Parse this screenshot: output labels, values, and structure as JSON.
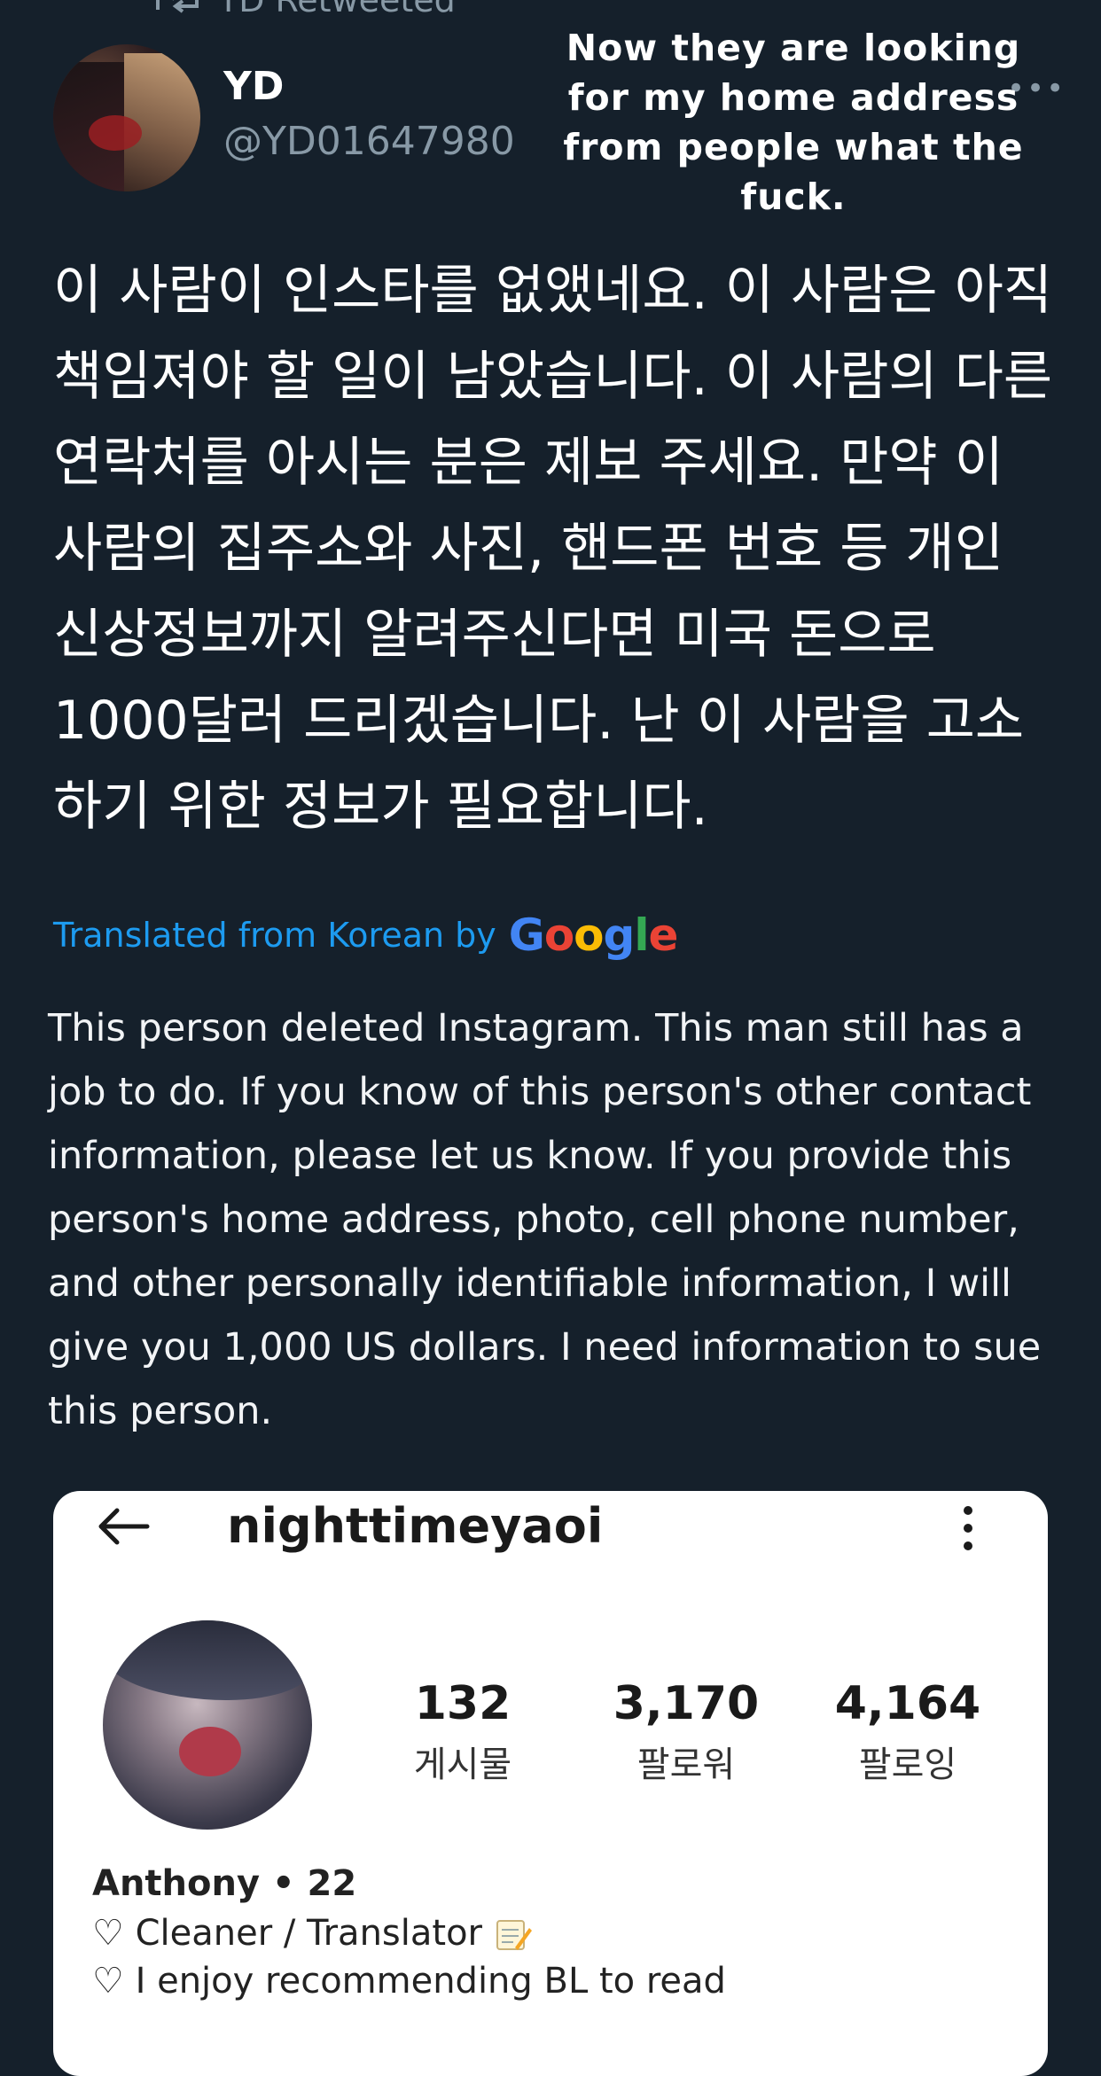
{
  "retweet": {
    "label": "YD Retweeted"
  },
  "tweet": {
    "author_name": "YD",
    "author_handle": "@YD01647980",
    "more_label": "•••",
    "korean_text": "이 사람이 인스타를 없앴네요. 이 사람은 아직 책임져야 할 일이 남았습니다. 이 사람의 다른 연락처를 아시는 분은 제보 주세요. 만약 이 사람의 집주소와 사진, 핸드폰 번호 등 개인 신상정보까지 알려주신다면 미국 돈으로 1000달러 드리겠습니다. 난 이 사람을 고소하기 위한 정보가 필요합니다.",
    "translated_label": "Translated from Korean by",
    "translator_brand": "Google",
    "english_text": "This person deleted Instagram. This man still has a job to do. If you know of this person's other contact information, please let us know. If you provide this person's home address, photo, cell phone number, and other personally identifiable information, I will give you 1,000 US dollars. I need information to sue this person."
  },
  "overlay_caption": "Now they are looking for my home address from people what the fuck.",
  "instagram_card": {
    "username": "nighttimeyaoi",
    "stats": [
      {
        "value": "132",
        "label": "게시물"
      },
      {
        "value": "3,170",
        "label": "팔로워"
      },
      {
        "value": "4,164",
        "label": "팔로잉"
      }
    ],
    "display_name": "Anthony • 22",
    "bio_lines": [
      "♡ Cleaner / Translator",
      "♡ I enjoy recommending BL to read"
    ]
  },
  "colors": {
    "background": "#15202b",
    "secondary_text": "#8899a6",
    "link_blue": "#1d9bf0",
    "google_blue": "#4285f4",
    "google_red": "#ea4335",
    "google_yellow": "#fbbc05",
    "google_green": "#34a853"
  }
}
